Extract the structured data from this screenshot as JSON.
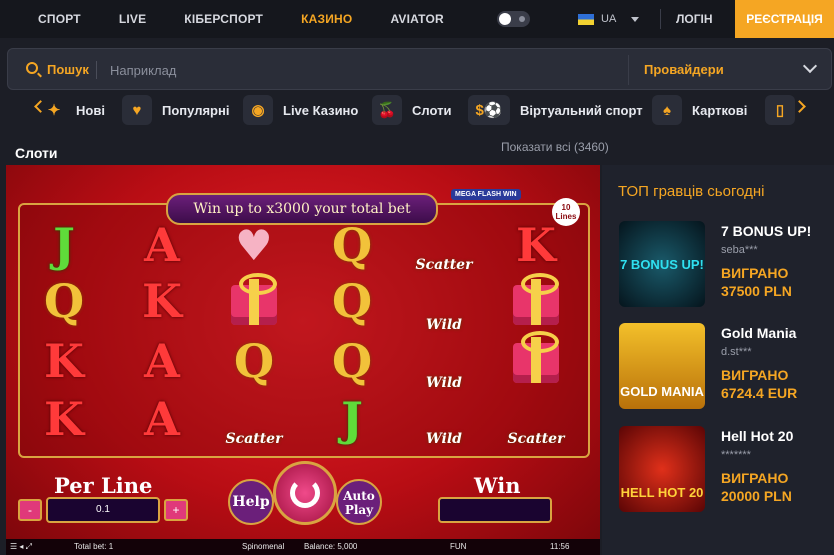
{
  "topnav": {
    "items": [
      "СПОРТ",
      "LIVE",
      "КІБЕРСПОРТ",
      "КАЗИНО",
      "AVIATOR"
    ],
    "active": "КАЗИНО",
    "language": "UA",
    "login": "ЛОГІН",
    "register": "РЕЄСТРАЦІЯ"
  },
  "search": {
    "label": "Пошук",
    "placeholder": "Наприклад",
    "providers": "Провайдери"
  },
  "categories": [
    {
      "label": "Нові",
      "icon": "new-icon"
    },
    {
      "label": "Популярні",
      "icon": "heart-icon"
    },
    {
      "label": "Live Казино",
      "icon": "live-icon"
    },
    {
      "label": "Слоти",
      "icon": "cherry-icon"
    },
    {
      "label": "Віртуальний спорт",
      "icon": "virtual-sport-icon"
    },
    {
      "label": "Карткові",
      "icon": "spade-icon"
    }
  ],
  "section": {
    "title": "Слоти",
    "show_all": "Показати всі (3460)"
  },
  "game": {
    "banner": "Win up to x3000 your total bet",
    "mega": "MEGA FLASH WIN",
    "lines": "10 Lines",
    "symbols": {
      "scatter": "Scatter",
      "wild": "Wild"
    },
    "per_line_label": "Per Line",
    "per_line_value": "0.1",
    "minus": "-",
    "plus": "+",
    "help": "Help",
    "auto_play_1": "Auto",
    "auto_play_2": "Play",
    "win_label": "Win",
    "status": {
      "total_bet": "Total bet: 1",
      "brand": "Spinomenal",
      "balance": "Balance: 5,000",
      "mode": "FUN",
      "time": "11:56"
    }
  },
  "top_players": {
    "title": "ТОП гравців сьогодні",
    "winners": [
      {
        "game": "7 BONUS UP!",
        "user": "seba***",
        "won": "ВИГРАНО",
        "amount": "37500 PLN",
        "thumb_text": "7 BONUS UP!"
      },
      {
        "game": "Gold Mania",
        "user": "d.st***",
        "won": "ВИГРАНО",
        "amount": "6724.4 EUR",
        "thumb_text": "GOLD MANIA"
      },
      {
        "game": "Hell Hot 20",
        "user": "*******",
        "won": "ВИГРАНО",
        "amount": "20000 PLN",
        "thumb_text": "HELL HOT 20"
      }
    ]
  }
}
